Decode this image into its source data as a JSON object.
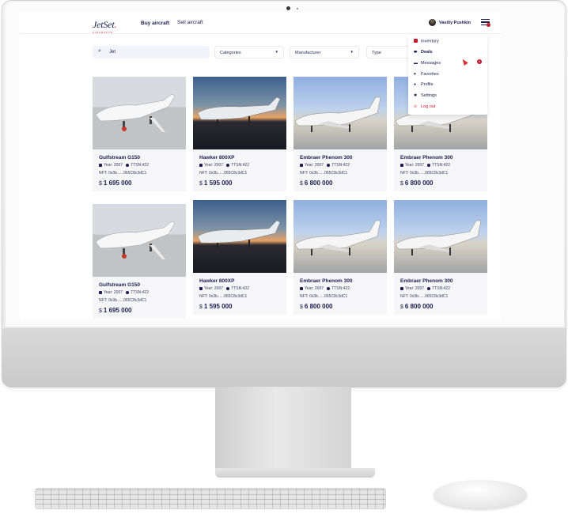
{
  "header": {
    "logo": "JetSet",
    "logo_sub": "AIRCRAFTS",
    "nav_buy": "Buy aircraft",
    "nav_sell": "Sell aircraft",
    "user_name": "Vasiliy Pushkin"
  },
  "filters": {
    "search_value": "Jet",
    "categories": "Categories",
    "manufacturer": "Manufacturer",
    "type": "Type"
  },
  "listings": [
    {
      "title": "Gulfstream G150",
      "year": "Year: 2007",
      "ttsn": "TTSN:422",
      "nft": "NFT: 0x3b......065C8c3dC1",
      "currency": "$",
      "price": "1 695 000"
    },
    {
      "title": "Hawker 800XP",
      "year": "Year: 2007",
      "ttsn": "TTSN:422",
      "nft": "NFT: 0x3b......065C8c3dC1",
      "currency": "$",
      "price": "1 595 000"
    },
    {
      "title": "Embraer Phenom 300",
      "year": "Year: 2007",
      "ttsn": "TTSN:422",
      "nft": "NFT: 0x3b......065C8c3dC1",
      "currency": "$",
      "price": "6 800 000"
    },
    {
      "title": "Embraer Phenom 300",
      "year": "Year: 2007",
      "ttsn": "TTSN:422",
      "nft": "NFT: 0x3b......065C8c3dC1",
      "currency": "$",
      "price": "6 800 000"
    },
    {
      "title": "Gulfstream G150",
      "year": "Year: 2007",
      "ttsn": "TTSN:422",
      "nft": "NFT: 0x3b......065C8c3dC1",
      "currency": "$",
      "price": "1 695 000"
    },
    {
      "title": "Hawker 800XP",
      "year": "Year: 2007",
      "ttsn": "TTSN:422",
      "nft": "NFT: 0x3b......065C8c3dC1",
      "currency": "$",
      "price": "1 595 000"
    },
    {
      "title": "Embraer Phenom 300",
      "year": "Year: 2007",
      "ttsn": "TTSN:422",
      "nft": "NFT: 0x3b......065C8c3dC1",
      "currency": "$",
      "price": "6 800 000"
    },
    {
      "title": "Embraer Phenom 300",
      "year": "Year: 2007",
      "ttsn": "TTSN:422",
      "nft": "NFT: 0x3b......065C8c3dC1",
      "currency": "$",
      "price": "6 800 000"
    }
  ],
  "dropdown": {
    "items": [
      "Inventory",
      "Deals",
      "Messages",
      "Favorites",
      "Profile",
      "Settings",
      "Log out"
    ],
    "messages_badge": "2"
  },
  "colors": {
    "brand_navy": "#1b1d4f",
    "accent_red": "#c21a2b",
    "search_bg": "#f2f3fb",
    "card_bg": "#f6f6f8"
  },
  "icons": {
    "search": "search-icon",
    "menu": "menu-icon",
    "year": "calendar-icon",
    "ttsn": "clock-icon",
    "nft": "token-icon"
  }
}
